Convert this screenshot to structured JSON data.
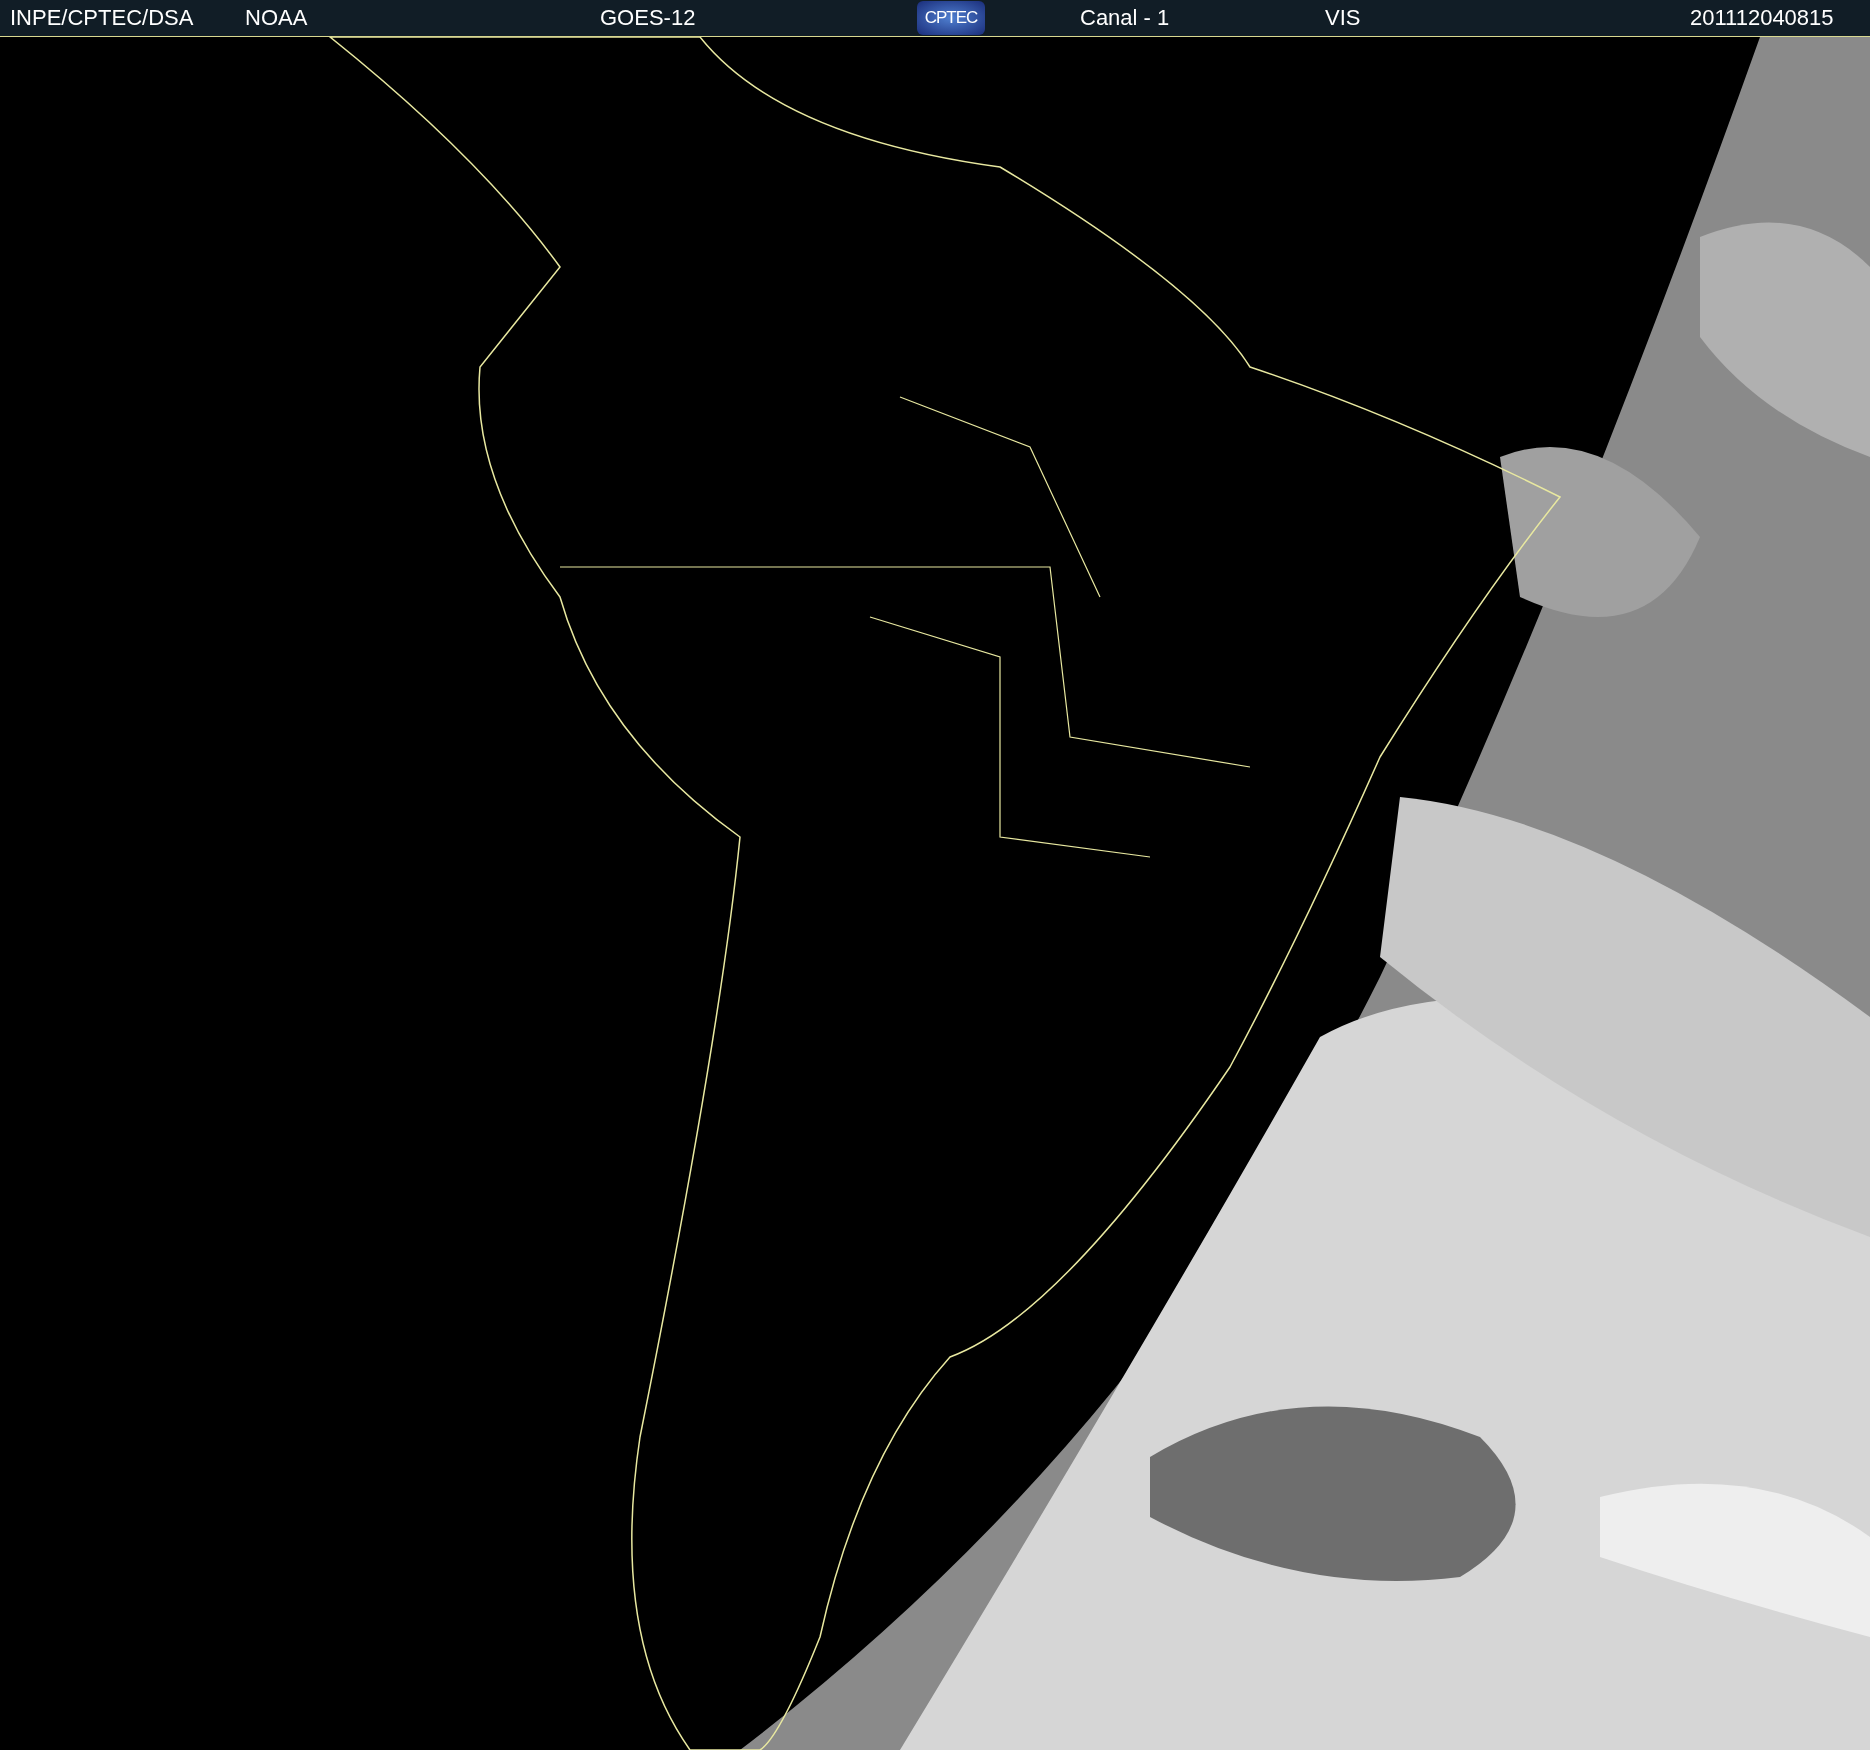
{
  "header": {
    "items": [
      {
        "kind": "text",
        "text": "INPE/CPTEC/DSA"
      },
      {
        "kind": "text",
        "text": "NOAA"
      },
      {
        "kind": "text",
        "text": "GOES-12"
      },
      {
        "kind": "logo",
        "text": "CPTEC"
      },
      {
        "kind": "text",
        "text": "Canal - 1"
      },
      {
        "kind": "text",
        "text": "VIS"
      },
      {
        "kind": "text",
        "text": "201112040815"
      }
    ]
  }
}
